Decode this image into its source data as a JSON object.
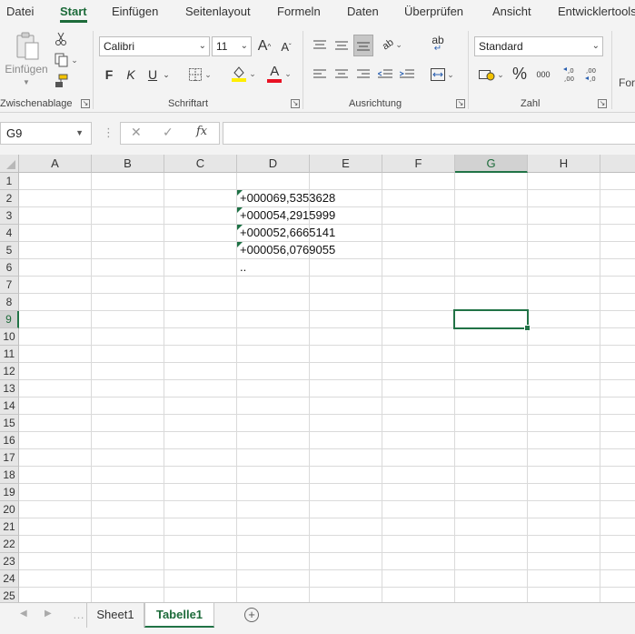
{
  "menu_tabs": [
    "Datei",
    "Start",
    "Einfügen",
    "Seitenlayout",
    "Formeln",
    "Daten",
    "Überprüfen",
    "Ansicht",
    "Entwicklertools"
  ],
  "active_tab": "Start",
  "ribbon": {
    "clipboard": {
      "paste_label": "Einfügen",
      "group_label": "Zwischenablage"
    },
    "font": {
      "font_name": "Calibri",
      "font_size": "11",
      "bold": "F",
      "italic": "K",
      "underline": "U",
      "grow": "A",
      "shrink": "A",
      "font_color_letter": "A",
      "group_label": "Schriftart"
    },
    "alignment": {
      "group_label": "Ausrichtung",
      "wrap_text": "ab"
    },
    "number": {
      "format": "Standard",
      "percent": "%",
      "thousands": "000",
      "group_label": "Zahl"
    },
    "styles_cut": "For"
  },
  "formula_bar": {
    "name_box": "G9",
    "cancel": "✕",
    "enter": "✓",
    "fx": "fx",
    "formula": ""
  },
  "columns": [
    "A",
    "B",
    "C",
    "D",
    "E",
    "F",
    "G",
    "H"
  ],
  "selected_column": "G",
  "rows": [
    "1",
    "2",
    "3",
    "4",
    "5",
    "6",
    "7",
    "8",
    "9",
    "10",
    "11",
    "12",
    "13",
    "14",
    "15",
    "16",
    "17",
    "18",
    "19",
    "20",
    "21",
    "22",
    "23",
    "24",
    "25"
  ],
  "selected_row": "9",
  "cells": {
    "D2": "+000069,5353628",
    "D3": "+000054,2915999",
    "D4": "+000052,6665141",
    "D5": "+000056,0769055",
    "D6": ".."
  },
  "sheets": [
    "Sheet1",
    "Tabelle1"
  ],
  "active_sheet": "Tabelle1",
  "colors": {
    "accent": "#217346",
    "active_tab_text": "#1d6b3a",
    "ribbon_bg": "#f3f3f3",
    "font_color_bar": "#e81123",
    "highlight_bar": "#ffee00"
  }
}
